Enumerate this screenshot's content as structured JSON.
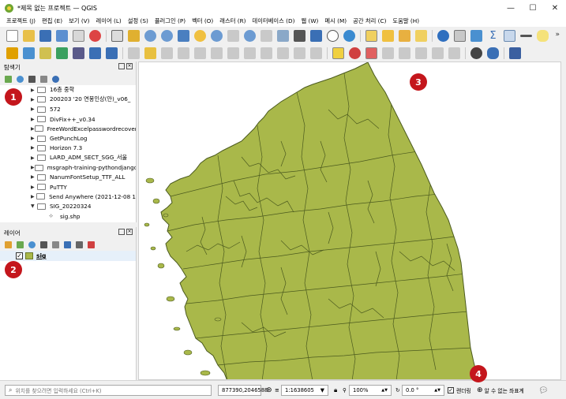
{
  "window": {
    "title": "*제목 없는 프로젝트 — QGIS",
    "minimize": "—",
    "maximize": "☐",
    "close": "✕"
  },
  "menu": [
    "프로젝트 (J)",
    "편집 (E)",
    "보기 (V)",
    "레이어 (L)",
    "설정 (S)",
    "플러그인 (P)",
    "벡터 (O)",
    "래스터 (R)",
    "데이터베이스 (D)",
    "웹 (W)",
    "메시 (M)",
    "공간 처리 (C)",
    "도움말 (H)"
  ],
  "browser_panel": {
    "title": "탐색기",
    "items": [
      "16층 중학",
      "200203 '20 연봉인상(안)_v06_",
      "572",
      "DivFix++_v0.34",
      "FreeWordExcelpasswordrecovery",
      "GetPunchLog",
      "Horizon 7.3",
      "LARD_ADM_SECT_SGG_서울",
      "msgraph-training-pythondjango",
      "NanumFontSetup_TTF_ALL",
      "PuTTY",
      "Send Anywhere (2021-12-08 1",
      "SIG_20220324"
    ],
    "child_item": "sig.shp"
  },
  "layers_panel": {
    "title": "레이어",
    "layer_name": "sig",
    "checked": "✓"
  },
  "statusbar": {
    "search_placeholder": "위치를 찾으려면 입력하세요 (Ctrl+K)",
    "coordinate": "877390,2046588",
    "scale": "1:1638605",
    "magnifier": "100%",
    "rotation": "0.0 °",
    "render_label": "렌더링",
    "crs_label": "알 수 없는 좌표계"
  },
  "markers": [
    "1",
    "2",
    "3",
    "4"
  ],
  "colors": {
    "land_fill": "#a9b84a",
    "boundary": "#4b5a1e",
    "marker": "#c4161c"
  }
}
